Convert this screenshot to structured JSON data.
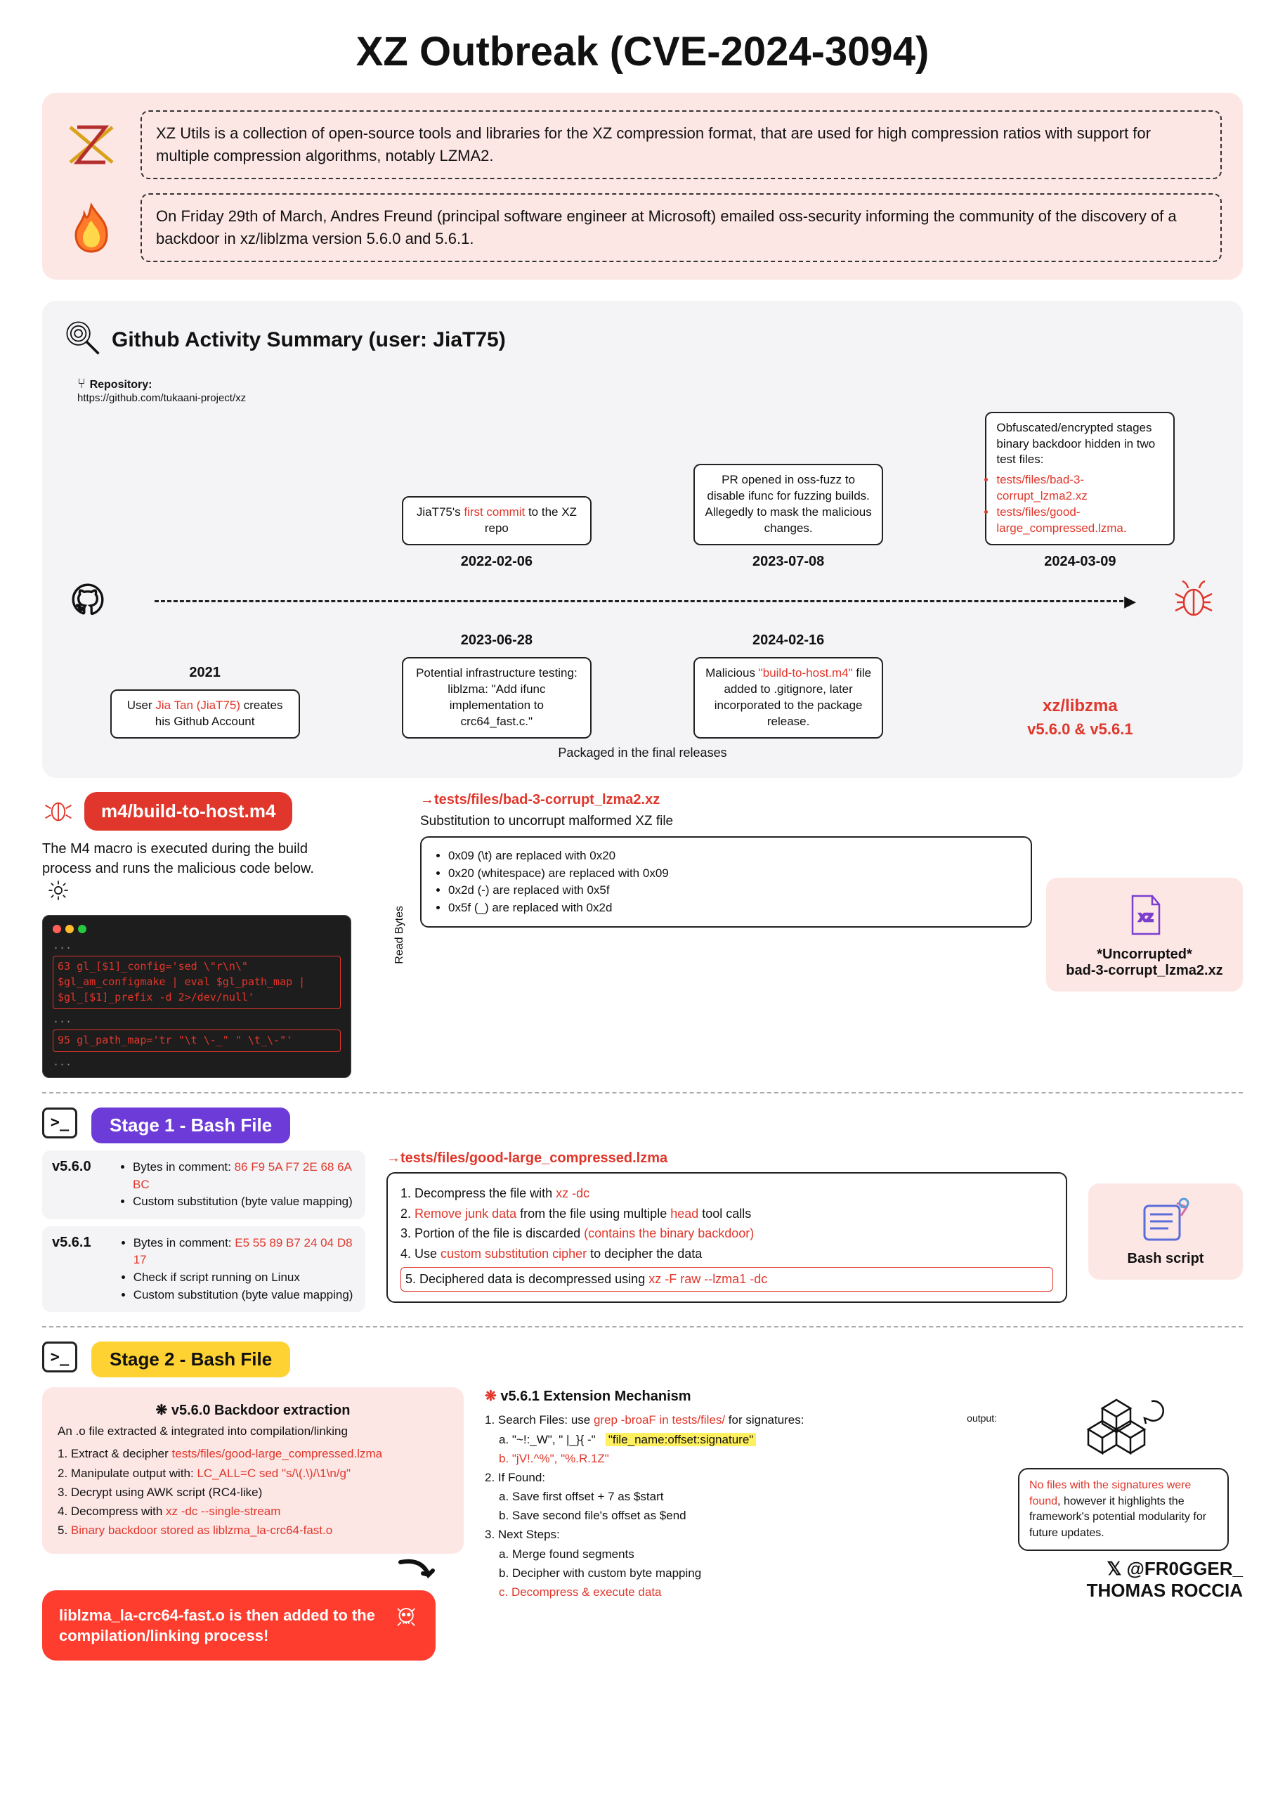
{
  "title": "XZ Outbreak (CVE-2024-3094)",
  "intro": {
    "box1": "XZ Utils is a collection of open-source tools and libraries for the XZ compression format, that are used for high compression ratios with support for multiple compression algorithms, notably LZMA2.",
    "box2": "On Friday 29th of March, Andres Freund (principal software engineer at Microsoft) emailed oss-security informing the community of the discovery of a backdoor in xz/liblzma version 5.6.0 and 5.6.1."
  },
  "github": {
    "heading": "Github Activity Summary (user: JiaT75)",
    "repo_label": "Repository:",
    "repo_url": "https://github.com/tukaani-project/xz",
    "events": [
      {
        "date": "2021",
        "text": "User Jia Tan (JiaT75) creates his Github Account",
        "highlight": "Jia Tan (JiaT75)"
      },
      {
        "date": "2022-02-06",
        "text": "JiaT75's first commit to the XZ repo",
        "highlight": "first commit"
      },
      {
        "date": "2023-06-28",
        "text": "Potential infrastructure testing: liblzma: \"Add ifunc implementation to crc64_fast.c.\""
      },
      {
        "date": "2023-07-08",
        "text": "PR opened in oss-fuzz to disable ifunc for fuzzing builds. Allegedly to mask the malicious changes."
      },
      {
        "date": "2024-02-16",
        "text": "Malicious \"build-to-host.m4\" file added to .gitignore, later incorporated to the package release.",
        "highlight": "\"build-to-host.m4\""
      },
      {
        "date": "2024-03-09",
        "text": "Obfuscated/encrypted stages binary backdoor hidden in two test files:",
        "files": [
          "tests/files/bad-3-corrupt_lzma2.xz",
          "tests/files/good-large_compressed.lzma."
        ]
      }
    ],
    "result_lib": "xz/libzma",
    "result_ver": "v5.6.0 & v5.6.1",
    "pkg_note": "Packaged in the final releases"
  },
  "m4": {
    "badge": "m4/build-to-host.m4",
    "desc": "The M4 macro is executed during the build process and runs the malicious code below.",
    "read_bytes": "Read Bytes",
    "terminal": {
      "l1_num": "63",
      "l1": "gl_[$1]_config='sed \\\"r\\n\\\" $gl_am_configmake | eval $gl_path_map | $gl_[$1]_prefix -d 2>/dev/null'",
      "l2_num": "95",
      "l2": "gl_path_map='tr \"\\t \\-_\" \" \\t_\\-\"'"
    },
    "tests_file": "tests/files/bad-3-corrupt_lzma2.xz",
    "sub_head": "Substitution to uncorrupt malformed XZ file",
    "subs": [
      "0x09 (\\t) are replaced with 0x20",
      "0x20 (whitespace) are replaced with 0x09",
      "0x2d (-) are replaced with 0x5f",
      "0x5f (_) are replaced with 0x2d"
    ],
    "uncorrupted_l1": "*Uncorrupted*",
    "uncorrupted_l2": "bad-3-corrupt_lzma2.xz"
  },
  "stage1": {
    "title": "Stage 1 - Bash File",
    "v560": {
      "ver": "v5.6.0",
      "bytes": "Bytes in comment: 86 F9 5A F7 2E 68 6A BC",
      "b2": "Custom substitution (byte value mapping)"
    },
    "v561": {
      "ver": "v5.6.1",
      "bytes": "Bytes in comment: E5 55 89 B7 24 04 D8 17",
      "b2": "Check if script running on Linux",
      "b3": "Custom substitution (byte value mapping)"
    },
    "tests_file": "tests/files/good-large_compressed.lzma",
    "steps": [
      {
        "n": "1.",
        "t": "Decompress the file with ",
        "r": "xz -dc"
      },
      {
        "n": "2.",
        "r": "Remove junk data",
        "t2": " from the file using multiple ",
        "r2": "head",
        "t3": " tool calls"
      },
      {
        "n": "3.",
        "t": "Portion of the file is discarded ",
        "r": "(contains the binary backdoor)"
      },
      {
        "n": "4.",
        "t": "Use ",
        "r": "custom substitution cipher",
        "t2": " to decipher the data"
      },
      {
        "n": "5.",
        "t": "Deciphered data is decompressed using ",
        "r": "xz -F raw --lzma1 -dc"
      }
    ],
    "result": "Bash script"
  },
  "stage2": {
    "title": "Stage 2 - Bash File",
    "left_head": "v5.6.0 Backdoor extraction",
    "left_intro": "An .o file extracted & integrated into compilation/linking",
    "left_steps": [
      {
        "n": "1.",
        "t": "Extract & decipher ",
        "r": "tests/files/good-large_compressed.lzma"
      },
      {
        "n": "2.",
        "t": "Manipulate output with: ",
        "r": "LC_ALL=C sed \"s/\\(.\\)/\\1\\n/g\""
      },
      {
        "n": "3.",
        "t": "Decrypt using AWK script (RC4-like)"
      },
      {
        "n": "4.",
        "t": "Decompress with ",
        "r": "xz -dc --single-stream"
      },
      {
        "n": "5.",
        "r": "Binary backdoor stored as liblzma_la-crc64-fast.o"
      }
    ],
    "pill": "liblzma_la-crc64-fast.o is then added to the compilation/linking process!",
    "right_head": "v5.6.1 Extension Mechanism",
    "right": {
      "s1": "Search Files: use ",
      "s1r": "grep -broaF in tests/files/",
      "s1b": " for signatures:",
      "out_label": "output:",
      "out_val": "\"file_name:offset:signature\"",
      "sig_a": "a. \"~!:_W\", \" |_}{ -\"",
      "sig_b": "b. \"jV!.^%\", \"%.R.1Z\"",
      "s2": "If Found:",
      "s2a": "a. Save first offset + 7 as $start",
      "s2b": "b. Save second file's offset as $end",
      "s3": "Next Steps:",
      "s3a": "a. Merge found segments",
      "s3b": "b. Decipher with custom byte mapping",
      "s3c": "c. Decompress & execute data"
    },
    "speech": "No files with the signatures were found, however it highlights the framework's potential modularity for future updates.",
    "speech_r": "No files with the signatures were found",
    "credit_handle": "@FR0GGER_",
    "credit_name": "THOMAS ROCCIA"
  }
}
